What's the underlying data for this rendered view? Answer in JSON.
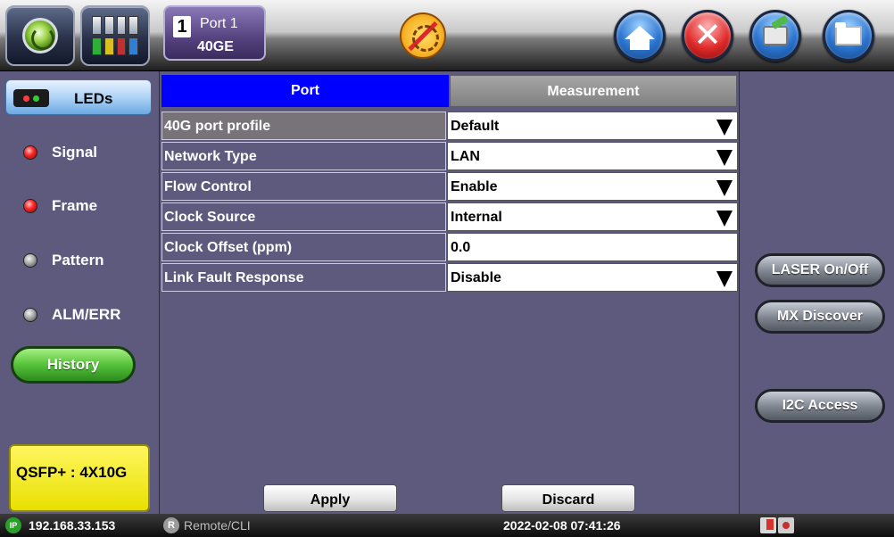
{
  "toolbar": {
    "port_tab": {
      "number": "1",
      "name": "Port 1",
      "speed": "40GE"
    },
    "icons": [
      "vepal-logo-icon",
      "apps-grid-icon",
      "laser-warning-icon",
      "home-icon",
      "close-icon",
      "export-icon",
      "folder-icon"
    ]
  },
  "left_panel": {
    "leds_tab_label": "LEDs",
    "leds": [
      {
        "label": "Signal",
        "state": "red"
      },
      {
        "label": "Frame",
        "state": "red"
      },
      {
        "label": "Pattern",
        "state": "gray"
      },
      {
        "label": "ALM/ERR",
        "state": "gray"
      }
    ],
    "history_label": "History",
    "module_label": "QSFP+ : 4X10G"
  },
  "tabs": {
    "port": "Port",
    "measurement": "Measurement"
  },
  "settings": [
    {
      "label": "40G port profile",
      "value": "Default",
      "dropdown": true
    },
    {
      "label": "Network Type",
      "value": "LAN",
      "dropdown": true
    },
    {
      "label": "Flow Control",
      "value": "Enable",
      "dropdown": true
    },
    {
      "label": "Clock Source",
      "value": "Internal",
      "dropdown": true
    },
    {
      "label": "Clock Offset (ppm)",
      "value": "0.0",
      "dropdown": false
    },
    {
      "label": "Link Fault Response",
      "value": "Disable",
      "dropdown": true
    }
  ],
  "actions": {
    "apply": "Apply",
    "discard": "Discard"
  },
  "right_panel": {
    "laser_label": "LASER On/Off",
    "mx_label": "MX Discover",
    "i2c_label": "I2C Access"
  },
  "statusbar": {
    "ip_badge": "IP",
    "ip": "192.168.33.153",
    "remote_badge": "R",
    "remote": "Remote/CLI",
    "datetime": "2022-02-08 07:41:26"
  },
  "colors": {
    "background": "#5e5a7e",
    "active_tab": "#0000ff",
    "led_red": "#ff2a2a",
    "led_gray": "#a8a8a8",
    "history_green": "#56c23a",
    "module_yellow": "#fff65f"
  }
}
